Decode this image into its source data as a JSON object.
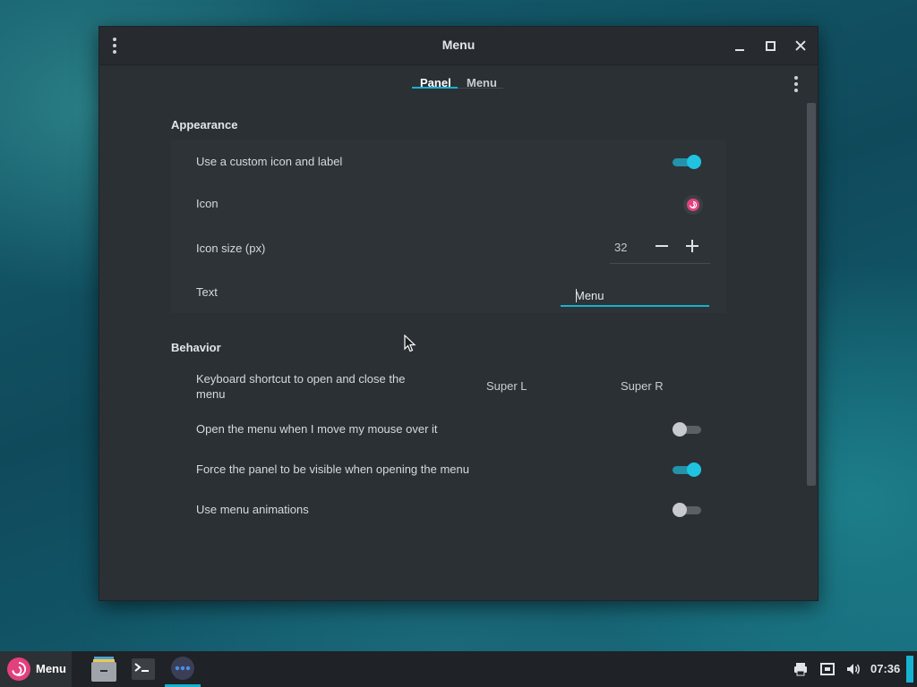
{
  "window": {
    "title": "Menu",
    "tabs": [
      {
        "label": "Panel",
        "active": true
      },
      {
        "label": "Menu",
        "active": false
      }
    ]
  },
  "appearance": {
    "title": "Appearance",
    "custom_icon_label": {
      "label": "Use a custom icon and label",
      "enabled": true
    },
    "icon": {
      "label": "Icon",
      "icon": "debian-swirl-icon"
    },
    "icon_size": {
      "label": "Icon size (px)",
      "value": "32"
    },
    "text": {
      "label": "Text",
      "value": "Menu"
    }
  },
  "behavior": {
    "title": "Behavior",
    "shortcut": {
      "label": "Keyboard shortcut to open and close the menu",
      "key1": "Super L",
      "key2": "Super R"
    },
    "hover_open": {
      "label": "Open the menu when I move my mouse over it",
      "enabled": false
    },
    "force_visible": {
      "label": "Force the panel to be visible when opening the menu",
      "enabled": true
    },
    "animations": {
      "label": "Use menu animations",
      "enabled": false
    }
  },
  "taskbar": {
    "menu_label": "Menu",
    "clock": "07:36",
    "tray_icons": [
      "printer-icon",
      "network-icon",
      "volume-icon"
    ],
    "tasks": [
      "file-manager-icon",
      "terminal-icon",
      "settings-app-icon"
    ]
  },
  "colors": {
    "accent": "#18b1cf",
    "window_bg": "#2b3035",
    "debian_red": "#e3407f"
  }
}
